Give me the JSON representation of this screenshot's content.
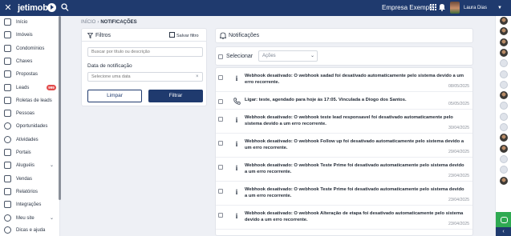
{
  "header": {
    "close_icon": "close-icon",
    "logo_text": "jetimob",
    "company": "Empresa Exemplo",
    "user_name": "Laura Dias",
    "colors": {
      "topbar": "#1f3a6e",
      "accent": "#1f3a6e",
      "badge": "#e24a4a"
    }
  },
  "sidebar": {
    "items": [
      {
        "label": "Início",
        "icon": "home-icon"
      },
      {
        "label": "Imóveis",
        "icon": "house-icon"
      },
      {
        "label": "Condomínios",
        "icon": "building-icon"
      },
      {
        "label": "Chaves",
        "icon": "key-icon"
      },
      {
        "label": "Propostas",
        "icon": "megaphone-icon"
      },
      {
        "label": "Leads",
        "icon": "leads-icon",
        "badge": "999"
      },
      {
        "label": "Roletas de leads",
        "icon": "roulette-icon"
      },
      {
        "label": "Pessoas",
        "icon": "people-icon"
      },
      {
        "label": "Oportunidades",
        "icon": "target-icon"
      },
      {
        "label": "Atividades",
        "icon": "check-circle-icon"
      },
      {
        "label": "Portais",
        "icon": "megaphone-icon"
      },
      {
        "label": "Aluguéis",
        "icon": "rent-icon",
        "chevron": "⌄"
      },
      {
        "label": "Vendas",
        "icon": "sales-icon"
      },
      {
        "label": "Relatórios",
        "icon": "report-icon"
      },
      {
        "label": "Integrações",
        "icon": "integration-icon"
      },
      {
        "label": "Meu site",
        "icon": "globe-icon",
        "chevron": "⌄"
      },
      {
        "label": "Dicas e ajuda",
        "icon": "help-icon"
      }
    ]
  },
  "breadcrumb": {
    "home": "INÍCIO",
    "separator": "›",
    "current": "NOTIFICAÇÕES"
  },
  "filters": {
    "title": "Filtros",
    "save_label": "Salvar filtro",
    "search_placeholder": "Buscar por título ou descrição",
    "date_label": "Data de notificação",
    "date_placeholder": "Selecione uma data",
    "clear_icon": "×",
    "clear_button": "Limpar",
    "filter_button": "Filtrar"
  },
  "notifications": {
    "title": "Notificações",
    "select_all_label": "Selecionar",
    "actions_placeholder": "Ações",
    "actions_caret": "⌄",
    "info_glyph": "i",
    "items": [
      {
        "type": "info",
        "message": "Webhook desativado: O webhook sadad foi desativado automaticamente pelo sistema devido a um erro recorrente.",
        "date": "08/05/2025"
      },
      {
        "type": "phone",
        "message": "Ligar: teste, agendado para hoje às 17:05. Vinculada a Diogo dos Santos.",
        "date": "05/05/2025"
      },
      {
        "type": "info",
        "message": "Webhook desativado: O webhook teste lead responsavel foi desativado automaticamente pelo sistema devido a um erro recorrente.",
        "date": "30/04/2025"
      },
      {
        "type": "info",
        "message": "Webhook desativado: O webhook Follow up foi desativado automaticamente pelo sistema devido a um erro recorrente.",
        "date": "29/04/2025"
      },
      {
        "type": "info",
        "message": "Webhook desativado: O webhook Teste Prime foi desativado automaticamente pelo sistema devido a um erro recorrente.",
        "date": "23/04/2025"
      },
      {
        "type": "info",
        "message": "Webhook desativado: O webhook Teste Prime foi desativado automaticamente pelo sistema devido a um erro recorrente.",
        "date": "23/04/2025"
      },
      {
        "type": "info",
        "message": "Webhook desativado: O webhook Alteração de etapa foi desativado automaticamente pelo sistema devido a um erro recorrente.",
        "date": "23/04/2025"
      }
    ]
  },
  "rail": {
    "avatars": [
      "photo",
      "photo",
      "photo",
      "photo",
      "placeholder",
      "placeholder",
      "placeholder",
      "photo",
      "placeholder",
      "placeholder",
      "placeholder",
      "photo",
      "photo",
      "placeholder",
      "placeholder",
      "photo"
    ],
    "collapse_glyph": "‹"
  }
}
